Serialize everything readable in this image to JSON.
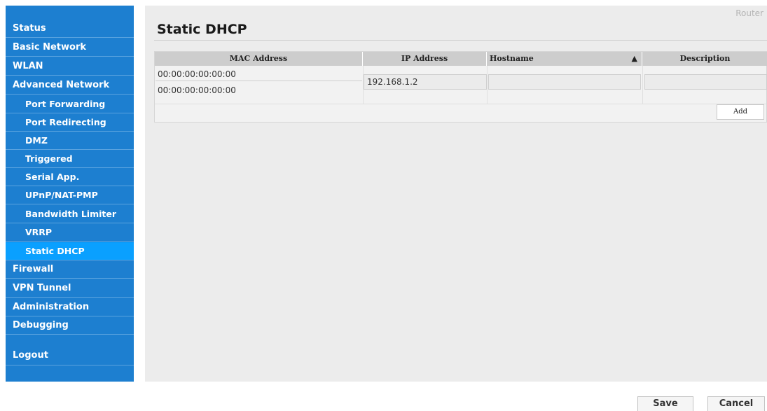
{
  "sidebar": {
    "items": [
      {
        "label": "Status"
      },
      {
        "label": "Basic Network"
      },
      {
        "label": "WLAN"
      },
      {
        "label": "Advanced Network"
      },
      {
        "label": "Port Forwarding"
      },
      {
        "label": "Port Redirecting"
      },
      {
        "label": "DMZ"
      },
      {
        "label": "Triggered"
      },
      {
        "label": "Serial App."
      },
      {
        "label": "UPnP/NAT-PMP"
      },
      {
        "label": "Bandwidth Limiter"
      },
      {
        "label": "VRRP"
      },
      {
        "label": "Static DHCP"
      },
      {
        "label": "Firewall"
      },
      {
        "label": "VPN Tunnel"
      },
      {
        "label": "Administration"
      },
      {
        "label": "Debugging"
      },
      {
        "label": "Logout"
      }
    ],
    "active": "Static DHCP"
  },
  "header": {
    "router_label": "Router",
    "page_title": "Static DHCP"
  },
  "table": {
    "columns": [
      "MAC Address",
      "IP Address",
      "Hostname",
      "Description"
    ],
    "sort_indicator": "▲",
    "rows": [
      {
        "mac_addresses": [
          "00:00:00:00:00:00",
          "00:00:00:00:00:00"
        ],
        "ip_address": "192.168.1.2",
        "hostname": "",
        "description": ""
      }
    ],
    "add_label": "Add"
  },
  "footer": {
    "save_label": "Save",
    "cancel_label": "Cancel"
  },
  "colors": {
    "sidebar_bg": "#1d7fd0",
    "sidebar_active": "#0aa0ff",
    "content_bg": "#ececec"
  }
}
